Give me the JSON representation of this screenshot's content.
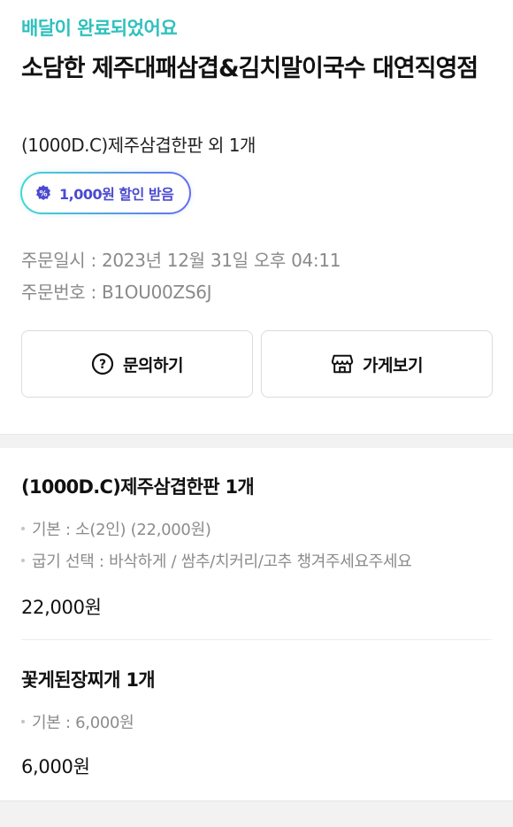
{
  "order": {
    "status": "배달이 완료되었어요",
    "store_name": "소담한 제주대패삼겹&김치말이국수 대연직영점",
    "summary": "(1000D.C)제주삼겹한판 외 1개",
    "discount_badge": "1,000원 할인 받음",
    "order_date": "주문일시 : 2023년 12월 31일 오후 04:11",
    "order_number": "주문번호 : B1OU00ZS6J"
  },
  "actions": {
    "inquiry_label": "문의하기",
    "store_label": "가게보기"
  },
  "items": [
    {
      "title": "(1000D.C)제주삼겹한판 1개",
      "options": [
        "기본 : 소(2인) (22,000원)",
        "굽기 선택 : 바삭하게 / 쌈추/치커리/고추 챙겨주세요주세요"
      ],
      "price": "22,000원"
    },
    {
      "title": "꽃게된장찌개 1개",
      "options": [
        "기본 : 6,000원"
      ],
      "price": "6,000원"
    }
  ],
  "colors": {
    "status": "#2fc1bd",
    "badge_text": "#4b4ad0",
    "badge_gradient_start": "#43d9cf",
    "badge_gradient_end": "#6b6bf0"
  },
  "icons": {
    "discount": "discount-coupon-icon",
    "inquiry": "question-circle-icon",
    "store": "store-icon"
  }
}
